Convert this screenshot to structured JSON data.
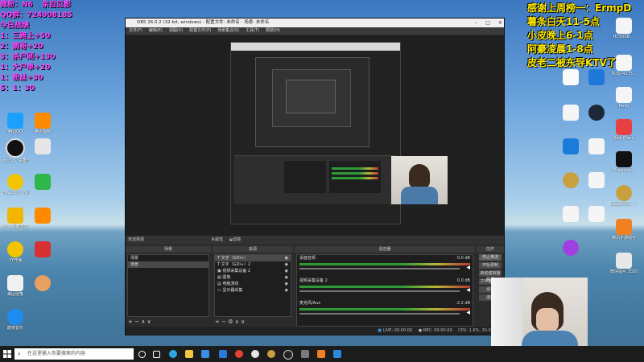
{
  "overlay": {
    "left_lines": [
      "微粉：N6",
      "亲自见影",
      "QQ群：724908185",
      "今日战绩",
      "1：三跨上+50",
      "2：鹅哥+20",
      "3：杀户刷+130",
      "1：大户单+20",
      "1：粉丝+30",
      "5：1：30"
    ],
    "right_lines": [
      "感谢上周榜一：ErmpD",
      "薯条白天11-5点",
      "小皮晚上6-1点",
      "阿豪凌晨1-8点",
      "皮老二被东导KTV了"
    ]
  },
  "desktop_icons_left": [
    "腾讯QQ",
    "腾讯视频",
    "obs32 - 快捷方式",
    "YYAnchor - 快捷方式",
    "YY - 快捷方式",
    "YY开播",
    "美团便笺",
    "酷狗音乐"
  ],
  "desktop_icons_right": [
    "HC50SB-...",
    "DUS74173...",
    "Hello",
    "Riot Client",
    "Phasmop...",
    "LeagueCli... - 快捷方式",
    "腾讯手游助手",
    "微信图片 2020101..."
  ],
  "obs": {
    "title": "OBS 26.0.2 (32-bit, windows) - 配置文件: 未命名 - 场景: 未命名",
    "menu": [
      "文件(F)",
      "编辑(E)",
      "视图(V)",
      "配置文件(P)",
      "场景集合(S)",
      "工具(T)",
      "帮助(H)"
    ],
    "no_source_selected": "未选择源",
    "properties_button": "属性",
    "filters_button": "滤镜",
    "docks": {
      "scenes_title": "场景",
      "sources_title": "来源",
      "mixer_title": "混音器",
      "controls_title": "控件"
    },
    "scenes": [
      "场景",
      "场景"
    ],
    "sources": [
      "文字（GDI+）",
      "文字（GDI+）2",
      "视频采集设备 2",
      "图像",
      "电脑游戏",
      "显示器采集"
    ],
    "mixer": [
      {
        "name": "桌面音频",
        "level": "0.0 dB"
      },
      {
        "name": "视频采集设备 2",
        "level": "0.0 dB"
      },
      {
        "name": "麦克风/Aux",
        "level": "-2.2 dB"
      }
    ],
    "controls": [
      "停止推流",
      "开始录制",
      "启动虚拟摄像机",
      "工作室模式",
      "设置",
      "退出"
    ],
    "status": {
      "live_label": "LIVE:",
      "live_time": "00:00:00",
      "rec_label": "REC:",
      "rec_time": "00:00:00",
      "cpu": "CPU: 1.6%, 30.00 fps"
    }
  },
  "taskbar": {
    "search_placeholder": "在这里输入你要搜索的内容"
  },
  "colors": {
    "overlay_left": "#ff44ff",
    "overlay_right": "#ffe800",
    "obs_bg": "#2b2b2b"
  }
}
